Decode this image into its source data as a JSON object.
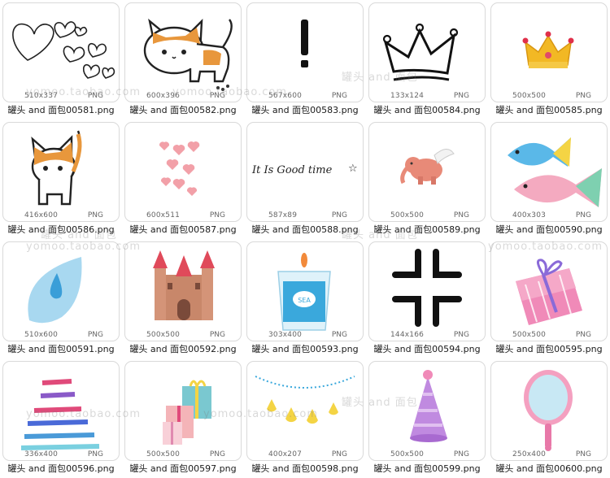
{
  "items": [
    {
      "dims": "510x337",
      "fmt": "PNG",
      "name": "罐头 and 面包00581.png",
      "icon": "hearts-icon"
    },
    {
      "dims": "600x396",
      "fmt": "PNG",
      "name": "罐头 and 面包00582.png",
      "icon": "cat-icon"
    },
    {
      "dims": "567x600",
      "fmt": "PNG",
      "name": "罐头 and 面包00583.png",
      "icon": "exclamation-icon"
    },
    {
      "dims": "133x124",
      "fmt": "PNG",
      "name": "罐头 and 面包00584.png",
      "icon": "crown-outline-icon"
    },
    {
      "dims": "500x500",
      "fmt": "PNG",
      "name": "罐头 and 面包00585.png",
      "icon": "gold-crown-icon"
    },
    {
      "dims": "416x600",
      "fmt": "PNG",
      "name": "罐头 and 面包00586.png",
      "icon": "sitting-cat-icon"
    },
    {
      "dims": "600x511",
      "fmt": "PNG",
      "name": "罐头 and 面包00587.png",
      "icon": "pink-hearts-icon"
    },
    {
      "dims": "587x89",
      "fmt": "PNG",
      "name": "罐头 and 面包00588.png",
      "icon": "lettering-icon",
      "art_text": "It Is Good time"
    },
    {
      "dims": "500x500",
      "fmt": "PNG",
      "name": "罐头 and 面包00589.png",
      "icon": "flying-elephant-icon"
    },
    {
      "dims": "400x303",
      "fmt": "PNG",
      "name": "罐头 and 面包00590.png",
      "icon": "fish-icon"
    },
    {
      "dims": "510x600",
      "fmt": "PNG",
      "name": "罐头 and 面包00591.png",
      "icon": "water-drop-icon"
    },
    {
      "dims": "500x500",
      "fmt": "PNG",
      "name": "罐头 and 面包00592.png",
      "icon": "castle-icon"
    },
    {
      "dims": "303x400",
      "fmt": "PNG",
      "name": "罐头 and 面包00593.png",
      "icon": "candle-icon",
      "art_text": "SEA"
    },
    {
      "dims": "144x166",
      "fmt": "PNG",
      "name": "罐头 and 面包00594.png",
      "icon": "anger-mark-icon"
    },
    {
      "dims": "500x500",
      "fmt": "PNG",
      "name": "罐头 and 面包00595.png",
      "icon": "gift-box-icon"
    },
    {
      "dims": "336x400",
      "fmt": "PNG",
      "name": "罐头 and 面包00596.png",
      "icon": "striped-dress-icon"
    },
    {
      "dims": "500x500",
      "fmt": "PNG",
      "name": "罐头 and 面包00597.png",
      "icon": "gift-stack-icon"
    },
    {
      "dims": "400x207",
      "fmt": "PNG",
      "name": "罐头 and 面包00598.png",
      "icon": "garland-icon"
    },
    {
      "dims": "500x500",
      "fmt": "PNG",
      "name": "罐头 and 面包00599.png",
      "icon": "party-hat-icon"
    },
    {
      "dims": "250x400",
      "fmt": "PNG",
      "name": "罐头 and 面包00600.png",
      "icon": "hand-mirror-icon"
    }
  ],
  "watermarks": {
    "shop": "罐头 and 面包",
    "url": "yomoo.taobao.com"
  }
}
